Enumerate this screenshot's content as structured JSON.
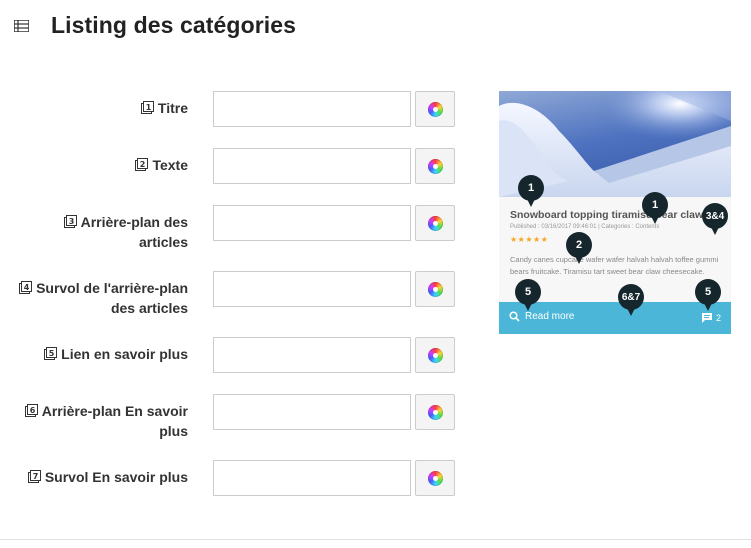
{
  "header": {
    "title": "Listing des catégories",
    "icon": "list-icon"
  },
  "fields": [
    {
      "num": "1",
      "label": "Titre",
      "value": ""
    },
    {
      "num": "2",
      "label": "Texte",
      "value": ""
    },
    {
      "num": "3",
      "label_line1": "Arrière-plan des",
      "label_line2": "articles",
      "value": ""
    },
    {
      "num": "4",
      "label_line1": "Survol de l'arrière-plan",
      "label_line2": "des articles",
      "value": ""
    },
    {
      "num": "5",
      "label": "Lien en savoir plus",
      "value": ""
    },
    {
      "num": "6",
      "label_line1": "Arrière-plan En savoir",
      "label_line2": "plus",
      "value": ""
    },
    {
      "num": "7",
      "label": "Survol En savoir plus",
      "value": ""
    }
  ],
  "preview": {
    "card_title": "Snowboard topping tiramisu bear claw",
    "meta": "Published : 03/16/2017 09:46:01 | Categories : Contents",
    "stars": "★★★★★",
    "excerpt": "Candy canes cupcake wafer wafer halvah halvah toffee gummi bears fruitcake. Tiramisu tart sweet bear claw cheesecake.",
    "read_more": "Read more",
    "comment_count": "2",
    "accent_color": "#4cb6d8",
    "pins": [
      "1",
      "1",
      "2",
      "3&4",
      "5",
      "6&7",
      "5"
    ]
  }
}
